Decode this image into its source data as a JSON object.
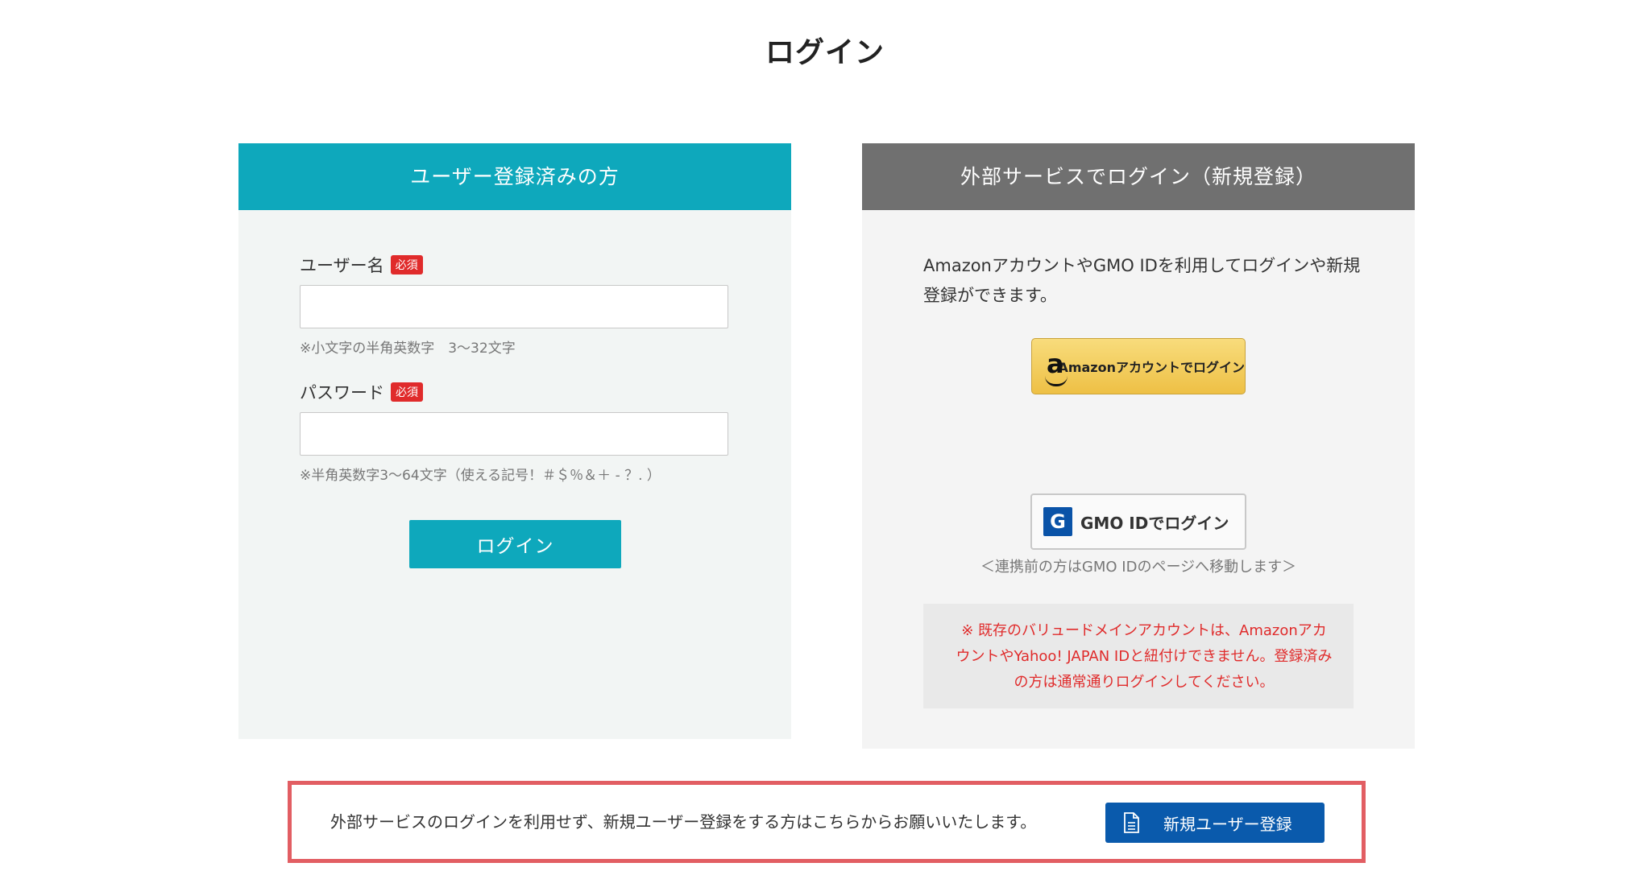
{
  "page": {
    "title": "ログイン"
  },
  "member_panel": {
    "header": "ユーザー登録済みの方",
    "username": {
      "label": "ユーザー名",
      "badge": "必須",
      "value": "",
      "placeholder": "",
      "hint": "※小文字の半角英数字　3〜32文字"
    },
    "password": {
      "label": "パスワード",
      "badge": "必須",
      "value": "",
      "placeholder": "",
      "hint": "※半角英数字3〜64文字（使える記号！＃＄％＆＋ - ？. ）"
    },
    "login_button": "ログイン"
  },
  "external_panel": {
    "header": "外部サービスでログイン（新規登録）",
    "intro": "AmazonアカウントやGMO IDを利用してログインや新規登録ができます。",
    "amazon_button": "Amazonアカウントでログイン",
    "amazon_logo_letter": "a",
    "gmo_button": "GMO IDでログイン",
    "gmo_logo_letter": "G",
    "gmo_note": "＜連携前の方はGMO IDのページへ移動します＞",
    "warning": "※ 既存のバリュードメインアカウントは、AmazonアカウントやYahoo! JAPAN IDと紐付けできません。登録済みの方は通常通りログインしてください。"
  },
  "register_section": {
    "text": "外部サービスのログインを利用せず、新規ユーザー登録をする方はこちらからお願いいたします。",
    "button": "新規ユーザー登録",
    "button_icon": "document-icon"
  },
  "colors": {
    "teal": "#0ea8bc",
    "gray_header": "#707070",
    "required_red": "#e02b2b",
    "register_blue": "#0a5aac",
    "highlight_border": "#e25e63"
  }
}
